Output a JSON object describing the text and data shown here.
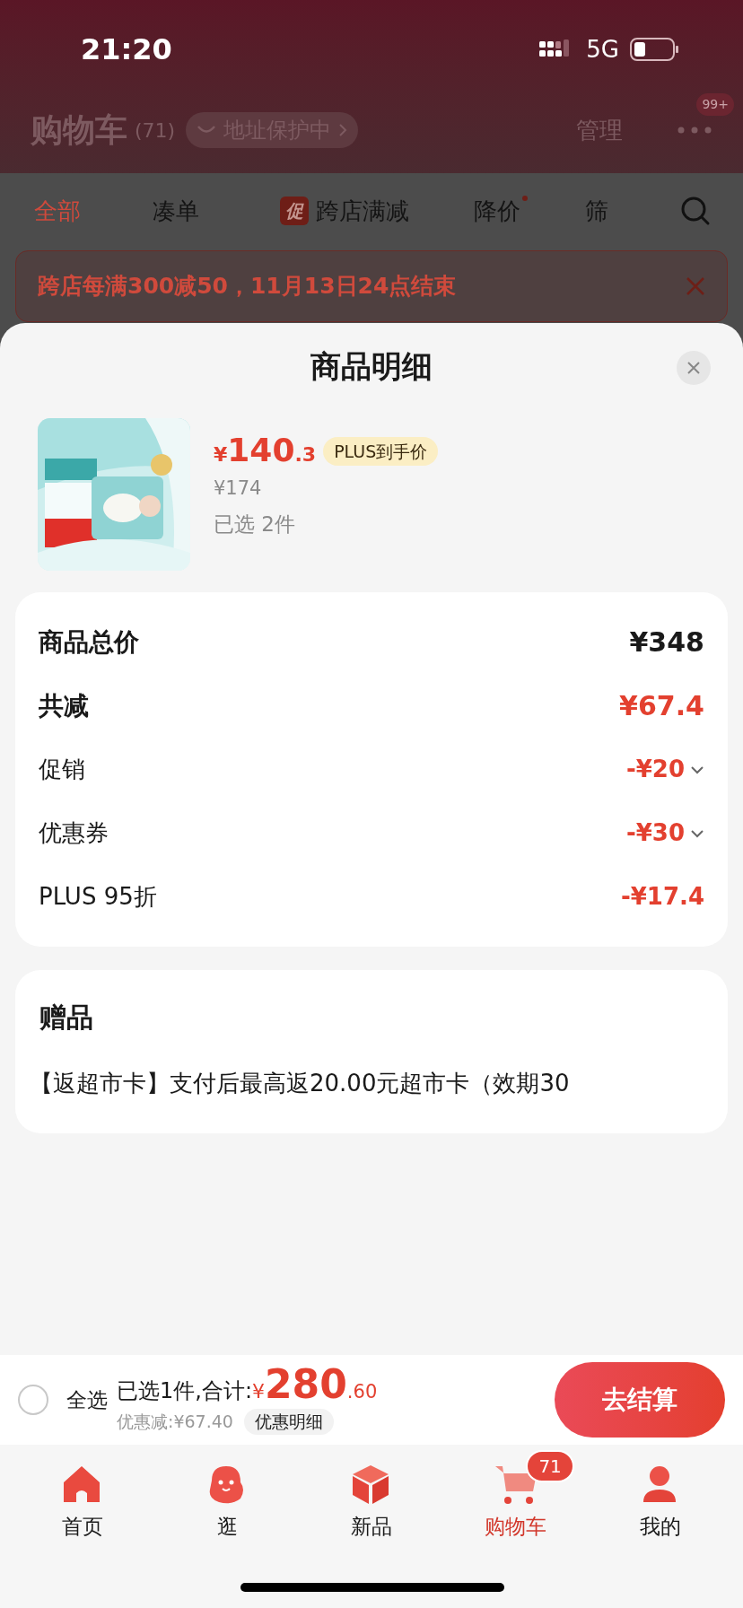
{
  "status_bar": {
    "time": "21:20",
    "network": "5G"
  },
  "cart_header": {
    "title": "购物车",
    "count": "(71)",
    "address_badge": "地址保护中",
    "manage": "管理",
    "more_badge": "99+"
  },
  "filter_tabs": [
    {
      "label": "全部",
      "selected": true
    },
    {
      "label": "凑单",
      "selected": false
    },
    {
      "label": "跨店满减",
      "selected": false,
      "badge": "促"
    },
    {
      "label": "降价",
      "selected": false,
      "dot": true
    },
    {
      "label": "筛",
      "selected": false
    }
  ],
  "promo_banner": {
    "text": "跨店每满300减50，11月13日24点结束"
  },
  "sheet": {
    "title": "商品明细",
    "product": {
      "currency": "¥",
      "price_int": "140",
      "price_dec": ".3",
      "tag": "PLUS到手价",
      "original_price": "¥174",
      "quantity": "已选 2件"
    },
    "summary_rows": [
      {
        "kind": "total",
        "label": "商品总价",
        "value": "¥348"
      },
      {
        "kind": "total_discount",
        "label": "共减",
        "value": "¥67.4"
      },
      {
        "kind": "discount",
        "label": "促销",
        "value": "-¥20",
        "expandable": true
      },
      {
        "kind": "discount",
        "label": "优惠券",
        "value": "-¥30",
        "expandable": true
      },
      {
        "kind": "discount",
        "label": "PLUS 95折",
        "value": "-¥17.4",
        "expandable": false
      }
    ],
    "gift": {
      "title": "赠品",
      "text": "【返超市卡】支付后最高返20.00元超市卡（效期30"
    }
  },
  "checkout_bar": {
    "select_all": {
      "label": "全选",
      "checked": false
    },
    "summary": "已选1件,合计:",
    "currency": "¥",
    "total_int": "280",
    "total_dec": ".60",
    "discount": "优惠减:¥67.40",
    "detail_button": "优惠明细",
    "checkout_button": "去结算"
  },
  "nav": [
    {
      "label": "首页",
      "kind": "home",
      "selected": false
    },
    {
      "label": "逛",
      "kind": "blob",
      "selected": false
    },
    {
      "label": "新品",
      "kind": "cube",
      "selected": false
    },
    {
      "label": "购物车",
      "kind": "cart",
      "selected": true,
      "badge": "71"
    },
    {
      "label": "我的",
      "kind": "person",
      "selected": false
    }
  ]
}
